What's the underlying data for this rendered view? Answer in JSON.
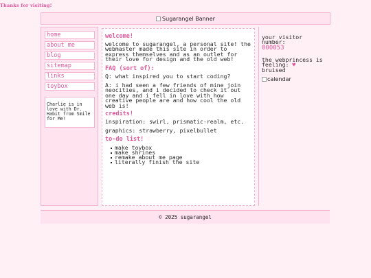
{
  "top_note": "Thanks for visiting!",
  "banner": {
    "alt": "Sugarangel Banner"
  },
  "nav": [
    "home",
    "about me",
    "blog",
    "sitemap",
    "links",
    "toybox"
  ],
  "note": "Charlie is in love with Dr. Habit from Smile for Me!",
  "main": {
    "welcome_heading": "welcome!",
    "welcome_text": "welcome to sugarangel, a personal site! the webmaster made this site in order to express themselves and as an outlet for their love for design and the old web!",
    "faq_heading": "FAQ (sort of):",
    "faq_q": "Q: what inspired you to start coding?",
    "faq_a": "A: i had seen a few friends of mine join neocities, and i decided to check it out one day and i fell in love with how creative people are and how cool the old web is!",
    "credits_heading": "credits!",
    "credits_inspiration": "inspiration: swirl, prismatic-realm, etc.",
    "credits_graphics": "graphics: strawberry, pixelbullet",
    "todo_heading": "to-do list!",
    "todo_icon": "♡",
    "todo_items": [
      "make toybox",
      "make shrines",
      "remake about me page",
      "literally finish the site"
    ]
  },
  "right": {
    "visitor_label": "your visitor number:",
    "visitor_number": "000053",
    "mood_label": "the webprincess is feeling:",
    "mood_icon": "♥",
    "mood_value": "bruised",
    "calendar_alt": "calendar"
  },
  "footer": "© 2025 sugarangel",
  "colors": {
    "accent": "#e0559a",
    "border": "#f4b3cf",
    "panel": "#ffe3ef",
    "background": "#fff0f6"
  }
}
